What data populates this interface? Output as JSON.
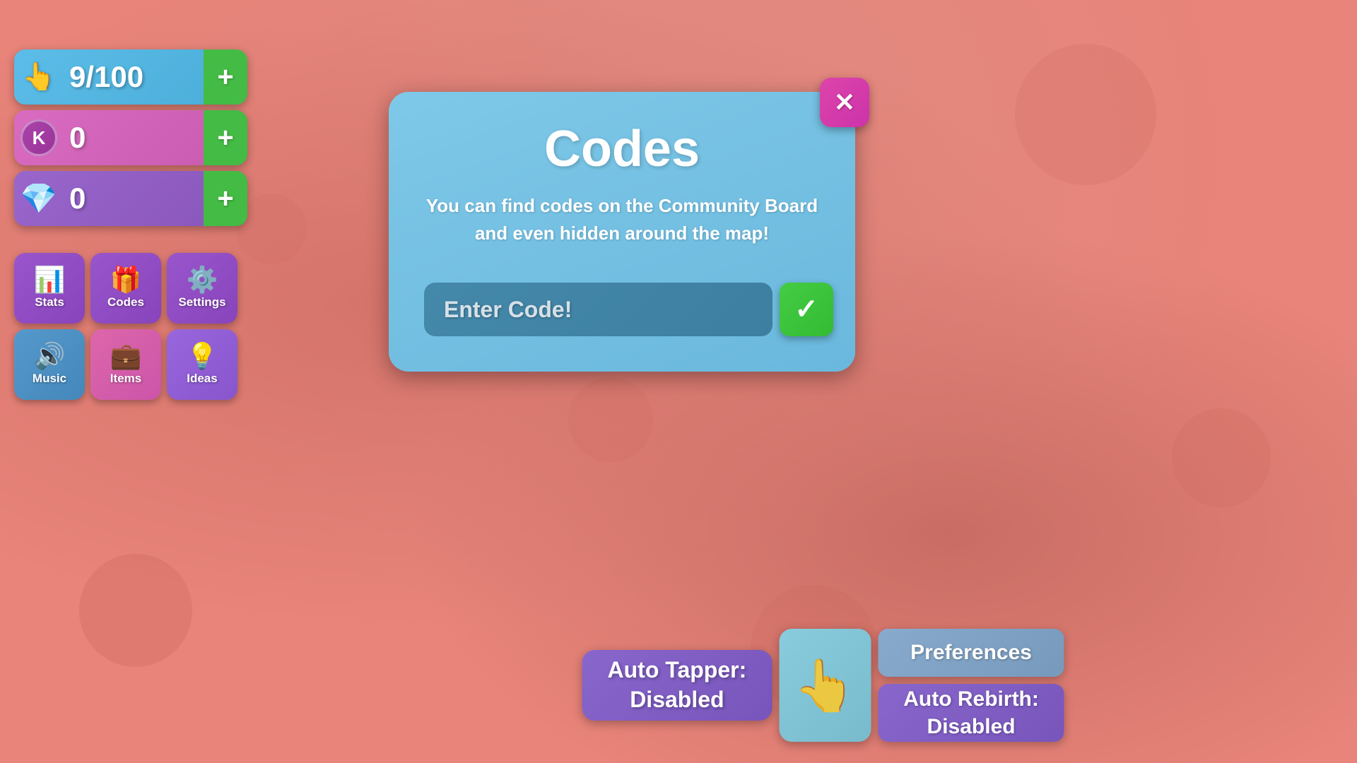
{
  "counters": {
    "clicks": {
      "value": "9/100",
      "plus_label": "+"
    },
    "k_currency": {
      "badge": "K",
      "value": "0",
      "plus_label": "+"
    },
    "diamonds": {
      "value": "0",
      "plus_label": "+"
    }
  },
  "menu_buttons": [
    {
      "id": "stats",
      "icon": "📊",
      "label": "Stats"
    },
    {
      "id": "codes",
      "icon": "🎁",
      "label": "Codes"
    },
    {
      "id": "settings",
      "icon": "⚙️",
      "label": "Settings"
    },
    {
      "id": "music",
      "icon": "🔊",
      "label": "Music"
    },
    {
      "id": "items",
      "icon": "💼",
      "label": "Items"
    },
    {
      "id": "ideas",
      "icon": "💡",
      "label": "Ideas"
    }
  ],
  "codes_modal": {
    "title": "Codes",
    "description": "You can find codes on the Community Board and even hidden around the map!",
    "input_placeholder": "Enter Code!",
    "submit_icon": "✓",
    "close_icon": "✕"
  },
  "bottom_panel": {
    "auto_tapper": {
      "line1": "Auto Tapper:",
      "line2": "Disabled"
    },
    "preferences_label": "Preferences",
    "auto_rebirth": {
      "line1": "Auto Rebirth:",
      "line2": "Disabled"
    }
  },
  "colors": {
    "bg": "#e8847a",
    "modal_bg": "#7ec8e8",
    "purple_btn": "#9955cc",
    "green": "#44cc44",
    "close_pink": "#dd44aa",
    "blue_bar": "#5bbde8",
    "pink_bar": "#d96cc0",
    "purple_bar": "#9966cc"
  }
}
